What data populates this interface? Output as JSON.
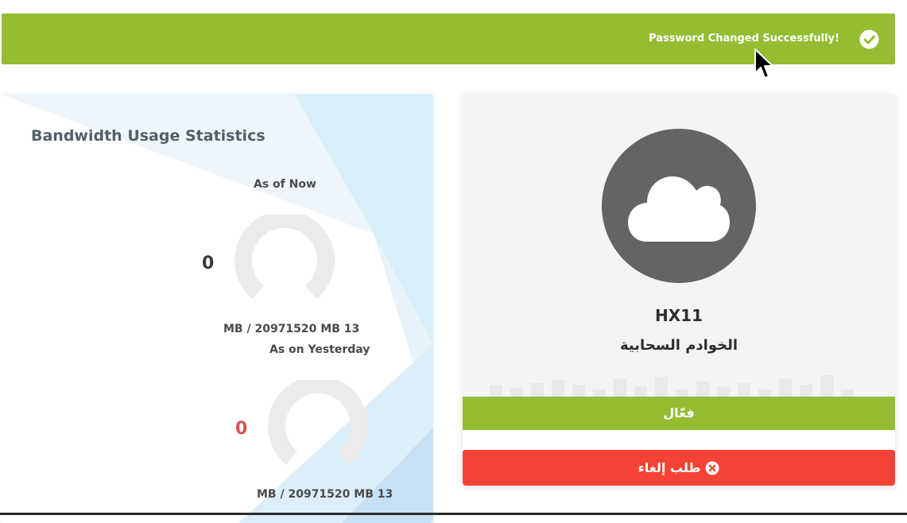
{
  "alert": {
    "message": "!Password Changed Successfully",
    "icon": "check-circle-icon",
    "color": "#94bd32"
  },
  "bandwidth": {
    "title": "Bandwidth Usage Statistics",
    "now": {
      "label": "As of Now",
      "value": "0",
      "usage": "MB / 20971520 MB 13",
      "value_color": "#3a3a3a"
    },
    "yesterday": {
      "label": "As on Yesterday",
      "value": "0",
      "usage": "MB / 20971520 MB 13",
      "value_color": "#d9534f"
    }
  },
  "server": {
    "icon": "cloud-icon",
    "name": "HX11",
    "type": "الخوادم السحابية",
    "status": "فعّال",
    "status_color": "#94bd32",
    "cancel_label": "طلب إلغاء",
    "cancel_icon": "times-circle-icon",
    "cancel_color": "#f44336"
  }
}
